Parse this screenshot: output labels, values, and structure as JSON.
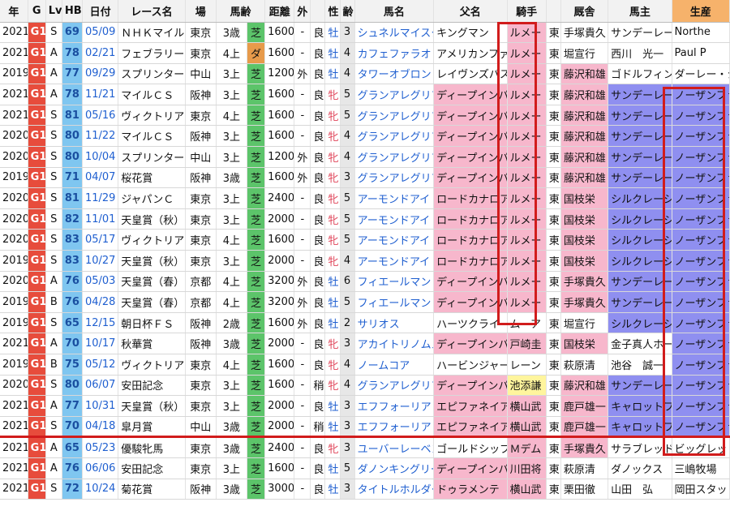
{
  "headers": [
    "年",
    "G",
    "Lv",
    "HB",
    "日付",
    "レース名",
    "場",
    "馬齢",
    "距離",
    "外",
    "",
    "性",
    "齢",
    "馬名",
    "父名",
    "騎手",
    "",
    "厩舎",
    "馬主",
    "生産"
  ],
  "rows": [
    {
      "year": "2021",
      "g": "G1",
      "lv": "S",
      "hb": "69",
      "date": "05/09",
      "race": "ＮＨＫマイル",
      "place": "東京",
      "age_cond": "3歳",
      "surface": "芝",
      "distance": "1600",
      "outer": "-",
      "going": "良",
      "sex": "牡",
      "age": "3",
      "horse": "シュネルマイスター",
      "sire": "キングマン",
      "jockey": "ルメー",
      "belong": "東",
      "trainer": "手塚貴久",
      "owner": "サンデーレー",
      "breeder": "Northe",
      "sire_hl": false,
      "jockey_hl": "pink",
      "trainer_hl": "",
      "owner_hl": "",
      "breeder_hl": ""
    },
    {
      "year": "2021",
      "g": "G1",
      "lv": "A",
      "hb": "78",
      "date": "02/21",
      "race": "フェブラリー",
      "place": "東京",
      "age_cond": "4上",
      "surface": "ダ",
      "distance": "1600",
      "outer": "-",
      "going": "良",
      "sex": "牡",
      "age": "4",
      "horse": "カフェファラオ",
      "sire": "アメリカンファラオ",
      "jockey": "ルメー",
      "belong": "東",
      "trainer": "堀宣行",
      "owner": "西川　光一",
      "breeder": "Paul P",
      "sire_hl": false,
      "jockey_hl": "pink",
      "trainer_hl": "",
      "owner_hl": "",
      "breeder_hl": ""
    },
    {
      "year": "2019",
      "g": "G1",
      "lv": "A",
      "hb": "77",
      "date": "09/29",
      "race": "スプリンター",
      "place": "中山",
      "age_cond": "3上",
      "surface": "芝",
      "distance": "1200",
      "outer": "外",
      "going": "良",
      "sex": "牡",
      "age": "4",
      "horse": "タワーオブロンドン",
      "sire": "レイヴンズパス",
      "jockey": "ルメー",
      "belong": "東",
      "trainer": "藤沢和雄",
      "owner": "ゴドルフィン",
      "breeder": "ダーレー・ジ",
      "sire_hl": false,
      "jockey_hl": "pink",
      "trainer_hl": "pink",
      "owner_hl": "",
      "breeder_hl": ""
    },
    {
      "year": "2021",
      "g": "G1",
      "lv": "A",
      "hb": "78",
      "date": "11/21",
      "race": "マイルＣＳ",
      "place": "阪神",
      "age_cond": "3上",
      "surface": "芝",
      "distance": "1600",
      "outer": "-",
      "going": "良",
      "sex": "牝",
      "age": "5",
      "horse": "グランアレグリア",
      "sire": "ディープインパクト",
      "jockey": "ルメー",
      "belong": "東",
      "trainer": "藤沢和雄",
      "owner": "サンデーレー",
      "breeder": "ノーザンファ",
      "sire_hl": true,
      "jockey_hl": "pink",
      "trainer_hl": "pink",
      "owner_hl": "purple",
      "breeder_hl": "purple"
    },
    {
      "year": "2021",
      "g": "G1",
      "lv": "S",
      "hb": "81",
      "date": "05/16",
      "race": "ヴィクトリア",
      "place": "東京",
      "age_cond": "4上",
      "surface": "芝",
      "distance": "1600",
      "outer": "-",
      "going": "良",
      "sex": "牝",
      "age": "5",
      "horse": "グランアレグリア",
      "sire": "ディープインパクト",
      "jockey": "ルメー",
      "belong": "東",
      "trainer": "藤沢和雄",
      "owner": "サンデーレー",
      "breeder": "ノーザンファ",
      "sire_hl": true,
      "jockey_hl": "pink",
      "trainer_hl": "pink",
      "owner_hl": "purple",
      "breeder_hl": "purple"
    },
    {
      "year": "2020",
      "g": "G1",
      "lv": "S",
      "hb": "80",
      "date": "11/22",
      "race": "マイルＣＳ",
      "place": "阪神",
      "age_cond": "3上",
      "surface": "芝",
      "distance": "1600",
      "outer": "-",
      "going": "良",
      "sex": "牝",
      "age": "4",
      "horse": "グランアレグリア",
      "sire": "ディープインパクト",
      "jockey": "ルメー",
      "belong": "東",
      "trainer": "藤沢和雄",
      "owner": "サンデーレー",
      "breeder": "ノーザンファ",
      "sire_hl": true,
      "jockey_hl": "pink",
      "trainer_hl": "pink",
      "owner_hl": "purple",
      "breeder_hl": "purple"
    },
    {
      "year": "2020",
      "g": "G1",
      "lv": "S",
      "hb": "80",
      "date": "10/04",
      "race": "スプリンター",
      "place": "中山",
      "age_cond": "3上",
      "surface": "芝",
      "distance": "1200",
      "outer": "外",
      "going": "良",
      "sex": "牝",
      "age": "4",
      "horse": "グランアレグリア",
      "sire": "ディープインパクト",
      "jockey": "ルメー",
      "belong": "東",
      "trainer": "藤沢和雄",
      "owner": "サンデーレー",
      "breeder": "ノーザンファ",
      "sire_hl": true,
      "jockey_hl": "pink",
      "trainer_hl": "pink",
      "owner_hl": "purple",
      "breeder_hl": "purple"
    },
    {
      "year": "2019",
      "g": "G1",
      "lv": "S",
      "hb": "71",
      "date": "04/07",
      "race": "桜花賞",
      "place": "阪神",
      "age_cond": "3歳",
      "surface": "芝",
      "distance": "1600",
      "outer": "外",
      "going": "良",
      "sex": "牝",
      "age": "3",
      "horse": "グランアレグリア",
      "sire": "ディープインパクト",
      "jockey": "ルメー",
      "belong": "東",
      "trainer": "藤沢和雄",
      "owner": "サンデーレー",
      "breeder": "ノーザンファ",
      "sire_hl": true,
      "jockey_hl": "pink",
      "trainer_hl": "pink",
      "owner_hl": "purple",
      "breeder_hl": "purple"
    },
    {
      "year": "2020",
      "g": "G1",
      "lv": "S",
      "hb": "81",
      "date": "11/29",
      "race": "ジャパンＣ",
      "place": "東京",
      "age_cond": "3上",
      "surface": "芝",
      "distance": "2400",
      "outer": "-",
      "going": "良",
      "sex": "牝",
      "age": "5",
      "horse": "アーモンドアイ",
      "sire": "ロードカナロア",
      "jockey": "ルメー",
      "belong": "東",
      "trainer": "国枝栄",
      "owner": "シルクレーシ",
      "breeder": "ノーザンファ",
      "sire_hl": true,
      "jockey_hl": "pink",
      "trainer_hl": "pink",
      "owner_hl": "purple",
      "breeder_hl": "purple"
    },
    {
      "year": "2020",
      "g": "G1",
      "lv": "S",
      "hb": "82",
      "date": "11/01",
      "race": "天皇賞（秋）",
      "place": "東京",
      "age_cond": "3上",
      "surface": "芝",
      "distance": "2000",
      "outer": "-",
      "going": "良",
      "sex": "牝",
      "age": "5",
      "horse": "アーモンドアイ",
      "sire": "ロードカナロア",
      "jockey": "ルメー",
      "belong": "東",
      "trainer": "国枝栄",
      "owner": "シルクレーシ",
      "breeder": "ノーザンファ",
      "sire_hl": true,
      "jockey_hl": "pink",
      "trainer_hl": "pink",
      "owner_hl": "purple",
      "breeder_hl": "purple"
    },
    {
      "year": "2020",
      "g": "G1",
      "lv": "S",
      "hb": "83",
      "date": "05/17",
      "race": "ヴィクトリア",
      "place": "東京",
      "age_cond": "4上",
      "surface": "芝",
      "distance": "1600",
      "outer": "-",
      "going": "良",
      "sex": "牝",
      "age": "5",
      "horse": "アーモンドアイ",
      "sire": "ロードカナロア",
      "jockey": "ルメー",
      "belong": "東",
      "trainer": "国枝栄",
      "owner": "シルクレーシ",
      "breeder": "ノーザンファ",
      "sire_hl": true,
      "jockey_hl": "pink",
      "trainer_hl": "pink",
      "owner_hl": "purple",
      "breeder_hl": "purple"
    },
    {
      "year": "2019",
      "g": "G1",
      "lv": "S",
      "hb": "83",
      "date": "10/27",
      "race": "天皇賞（秋）",
      "place": "東京",
      "age_cond": "3上",
      "surface": "芝",
      "distance": "2000",
      "outer": "-",
      "going": "良",
      "sex": "牝",
      "age": "4",
      "horse": "アーモンドアイ",
      "sire": "ロードカナロア",
      "jockey": "ルメー",
      "belong": "東",
      "trainer": "国枝栄",
      "owner": "シルクレーシ",
      "breeder": "ノーザンファ",
      "sire_hl": true,
      "jockey_hl": "pink",
      "trainer_hl": "pink",
      "owner_hl": "purple",
      "breeder_hl": "purple"
    },
    {
      "year": "2020",
      "g": "G1",
      "lv": "A",
      "hb": "76",
      "date": "05/03",
      "race": "天皇賞（春）",
      "place": "京都",
      "age_cond": "4上",
      "surface": "芝",
      "distance": "3200",
      "outer": "外",
      "going": "良",
      "sex": "牡",
      "age": "6",
      "horse": "フィエールマン",
      "sire": "ディープインパクト",
      "jockey": "ルメー",
      "belong": "東",
      "trainer": "手塚貴久",
      "owner": "サンデーレー",
      "breeder": "ノーザンファ",
      "sire_hl": true,
      "jockey_hl": "pink",
      "trainer_hl": "pink",
      "owner_hl": "purple",
      "breeder_hl": "purple"
    },
    {
      "year": "2019",
      "g": "G1",
      "lv": "B",
      "hb": "76",
      "date": "04/28",
      "race": "天皇賞（春）",
      "place": "京都",
      "age_cond": "4上",
      "surface": "芝",
      "distance": "3200",
      "outer": "外",
      "going": "良",
      "sex": "牡",
      "age": "5",
      "horse": "フィエールマン",
      "sire": "ディープインパクト",
      "jockey": "ルメー",
      "belong": "東",
      "trainer": "手塚貴久",
      "owner": "サンデーレー",
      "breeder": "ノーザンファ",
      "sire_hl": true,
      "jockey_hl": "pink",
      "trainer_hl": "pink",
      "owner_hl": "purple",
      "breeder_hl": "purple"
    },
    {
      "year": "2019",
      "g": "G1",
      "lv": "S",
      "hb": "65",
      "date": "12/15",
      "race": "朝日杯ＦＳ",
      "place": "阪神",
      "age_cond": "2歳",
      "surface": "芝",
      "distance": "1600",
      "outer": "外",
      "going": "良",
      "sex": "牡",
      "age": "2",
      "horse": "サリオス",
      "sire": "ハーツクライ",
      "jockey": "ムーア",
      "belong": "東",
      "trainer": "堀宣行",
      "owner": "シルクレーシ",
      "breeder": "ノーザンファ",
      "sire_hl": false,
      "jockey_hl": "",
      "trainer_hl": "",
      "owner_hl": "purple",
      "breeder_hl": "purple"
    },
    {
      "year": "2021",
      "g": "G1",
      "lv": "A",
      "hb": "70",
      "date": "10/17",
      "race": "秋華賞",
      "place": "阪神",
      "age_cond": "3歳",
      "surface": "芝",
      "distance": "2000",
      "outer": "-",
      "going": "良",
      "sex": "牝",
      "age": "3",
      "horse": "アカイトリノムスメ",
      "sire": "ディープインパクト",
      "jockey": "戸崎圭",
      "belong": "東",
      "trainer": "国枝栄",
      "owner": "金子真人ホー",
      "breeder": "ノーザンファ",
      "sire_hl": true,
      "jockey_hl": "pink",
      "trainer_hl": "pink",
      "owner_hl": "",
      "breeder_hl": "purple"
    },
    {
      "year": "2019",
      "g": "G1",
      "lv": "B",
      "hb": "75",
      "date": "05/12",
      "race": "ヴィクトリア",
      "place": "東京",
      "age_cond": "4上",
      "surface": "芝",
      "distance": "1600",
      "outer": "-",
      "going": "良",
      "sex": "牝",
      "age": "4",
      "horse": "ノームコア",
      "sire": "ハービンジャー",
      "jockey": "レーン",
      "belong": "東",
      "trainer": "萩原清",
      "owner": "池谷　誠一",
      "breeder": "ノーザンファ",
      "sire_hl": false,
      "jockey_hl": "",
      "trainer_hl": "",
      "owner_hl": "",
      "breeder_hl": "purple"
    },
    {
      "year": "2020",
      "g": "G1",
      "lv": "S",
      "hb": "80",
      "date": "06/07",
      "race": "安田記念",
      "place": "東京",
      "age_cond": "3上",
      "surface": "芝",
      "distance": "1600",
      "outer": "-",
      "going": "稍",
      "sex": "牝",
      "age": "4",
      "horse": "グランアレグリア",
      "sire": "ディープインパクト",
      "jockey": "池添謙",
      "belong": "東",
      "trainer": "藤沢和雄",
      "owner": "サンデーレー",
      "breeder": "ノーザンファ",
      "sire_hl": true,
      "jockey_hl": "yellow",
      "trainer_hl": "pink",
      "owner_hl": "purple",
      "breeder_hl": "purple"
    },
    {
      "year": "2021",
      "g": "G1",
      "lv": "A",
      "hb": "77",
      "date": "10/31",
      "race": "天皇賞（秋）",
      "place": "東京",
      "age_cond": "3上",
      "surface": "芝",
      "distance": "2000",
      "outer": "-",
      "going": "良",
      "sex": "牡",
      "age": "3",
      "horse": "エフフォーリア",
      "sire": "エピファネイア",
      "jockey": "横山武",
      "belong": "東",
      "trainer": "鹿戸雄一",
      "owner": "キャロットフ",
      "breeder": "ノーザンファ",
      "sire_hl": true,
      "jockey_hl": "pink",
      "trainer_hl": "pink",
      "owner_hl": "purple",
      "breeder_hl": "purple"
    },
    {
      "year": "2021",
      "g": "G1",
      "lv": "S",
      "hb": "70",
      "date": "04/18",
      "race": "皐月賞",
      "place": "中山",
      "age_cond": "3歳",
      "surface": "芝",
      "distance": "2000",
      "outer": "-",
      "going": "稍",
      "sex": "牡",
      "age": "3",
      "horse": "エフフォーリア",
      "sire": "エピファネイア",
      "jockey": "横山武",
      "belong": "東",
      "trainer": "鹿戸雄一",
      "owner": "キャロットフ",
      "breeder": "ノーザンファ",
      "sire_hl": true,
      "jockey_hl": "pink",
      "trainer_hl": "pink",
      "owner_hl": "purple",
      "breeder_hl": "purple",
      "sep": true
    },
    {
      "year": "2021",
      "g": "G1",
      "lv": "A",
      "hb": "65",
      "date": "05/23",
      "race": "優駿牝馬",
      "place": "東京",
      "age_cond": "3歳",
      "surface": "芝",
      "distance": "2400",
      "outer": "-",
      "going": "良",
      "sex": "牝",
      "age": "3",
      "horse": "ユーバーレーベン",
      "sire": "ゴールドシップ",
      "jockey": "Ｍデム",
      "belong": "東",
      "trainer": "手塚貴久",
      "owner": "サラブレッド",
      "breeder": "ビッグレッド",
      "sire_hl": false,
      "jockey_hl": "pink",
      "trainer_hl": "pink",
      "owner_hl": "",
      "breeder_hl": ""
    },
    {
      "year": "2021",
      "g": "G1",
      "lv": "A",
      "hb": "76",
      "date": "06/06",
      "race": "安田記念",
      "place": "東京",
      "age_cond": "3上",
      "surface": "芝",
      "distance": "1600",
      "outer": "-",
      "going": "良",
      "sex": "牡",
      "age": "5",
      "horse": "ダノンキングリー",
      "sire": "ディープインパクト",
      "jockey": "川田将",
      "belong": "東",
      "trainer": "萩原清",
      "owner": "ダノックス",
      "breeder": "三嶋牧場",
      "sire_hl": true,
      "jockey_hl": "pink",
      "trainer_hl": "",
      "owner_hl": "",
      "breeder_hl": ""
    },
    {
      "year": "2021",
      "g": "G1",
      "lv": "S",
      "hb": "72",
      "date": "10/24",
      "race": "菊花賞",
      "place": "阪神",
      "age_cond": "3歳",
      "surface": "芝",
      "distance": "3000",
      "outer": "-",
      "going": "良",
      "sex": "牡",
      "age": "3",
      "horse": "タイトルホルダー",
      "sire": "ドゥラメンテ",
      "jockey": "横山武",
      "belong": "東",
      "trainer": "栗田徹",
      "owner": "山田　弘",
      "breeder": "岡田スタッド",
      "sire_hl": true,
      "jockey_hl": "pink",
      "trainer_hl": "",
      "owner_hl": "",
      "breeder_hl": ""
    }
  ]
}
